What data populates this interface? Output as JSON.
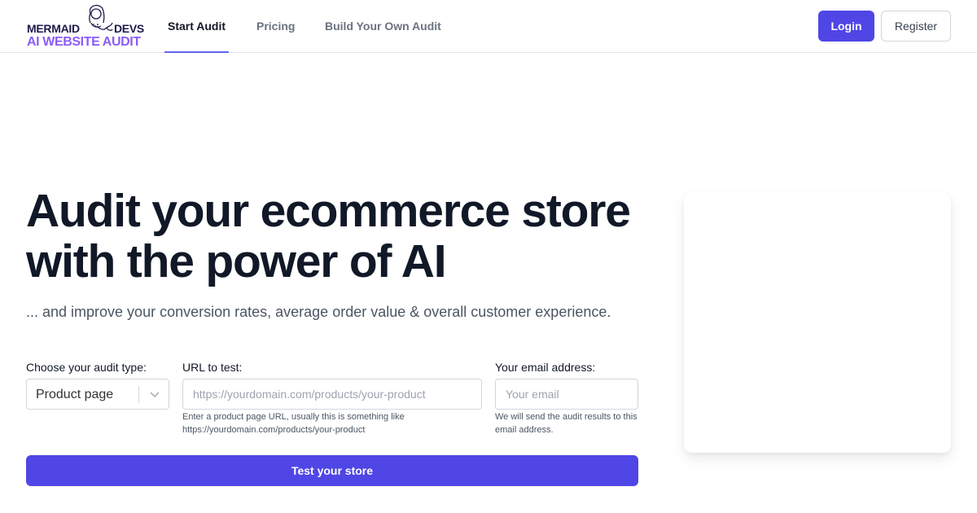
{
  "brand": {
    "line1_left": "MERMAID",
    "line1_right": "DEVS",
    "line2": "AI WEBSITE AUDIT",
    "logo_icon": "mermaid-icon",
    "primary_color": "#1e1b4b",
    "accent_color": "#8b5cf6"
  },
  "nav": {
    "tabs": [
      {
        "label": "Start Audit",
        "active": true
      },
      {
        "label": "Pricing",
        "active": false
      },
      {
        "label": "Build Your Own Audit",
        "active": false
      }
    ],
    "login_label": "Login",
    "register_label": "Register",
    "accent_color": "#4f46e5"
  },
  "hero": {
    "title": "Audit your ecommerce store with the power of AI",
    "subtitle": "... and improve your conversion rates, average order value & overall customer experience."
  },
  "form": {
    "audit_type": {
      "label": "Choose your audit type:",
      "selected": "Product page",
      "chevron_icon": "chevron-down-icon"
    },
    "url": {
      "label": "URL to test:",
      "placeholder": "https://yourdomain.com/products/your-product",
      "value": "",
      "help": "Enter a product page URL, usually this is something like https://yourdomain.com/products/your-product"
    },
    "email": {
      "label": "Your email address:",
      "placeholder": "Your email",
      "value": "",
      "help": "We will send the audit results to this email address."
    },
    "submit_label": "Test your store"
  }
}
